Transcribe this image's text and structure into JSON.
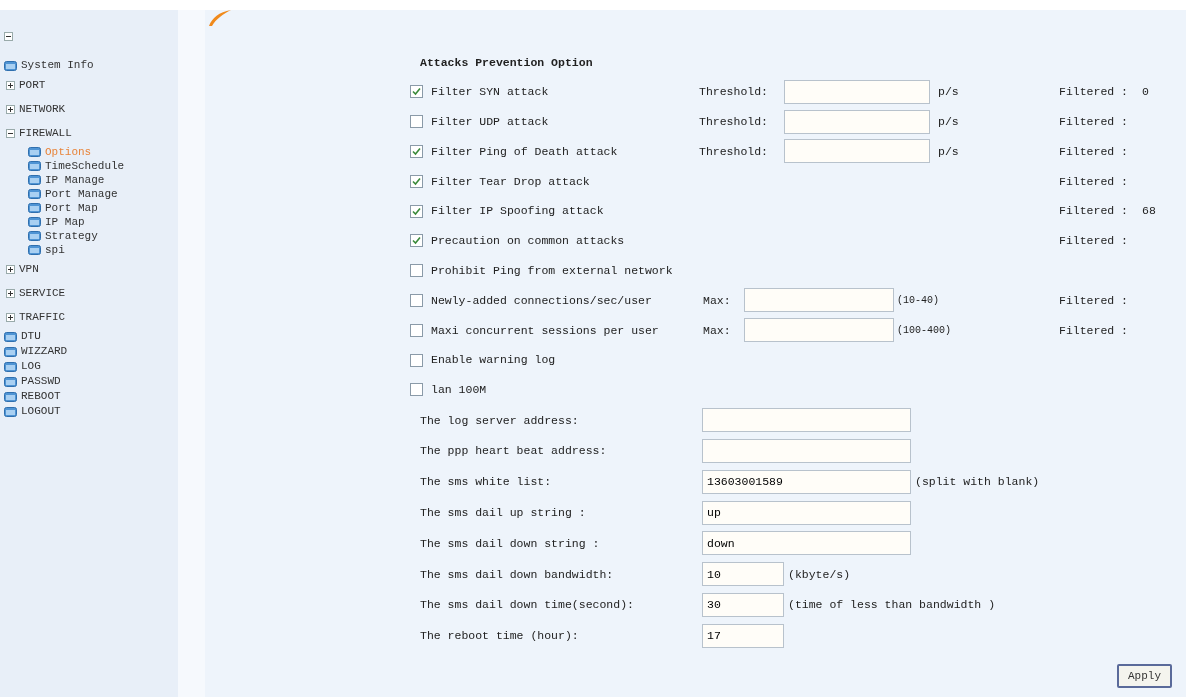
{
  "sidebar": {
    "expanded": true,
    "items": [
      {
        "label": "System Info",
        "kind": "leaf",
        "selected": false
      },
      {
        "label": "PORT",
        "kind": "folder",
        "expanded": false,
        "selected": false
      },
      {
        "label": "NETWORK",
        "kind": "folder",
        "expanded": false,
        "selected": false
      },
      {
        "label": "FIREWALL",
        "kind": "folder",
        "expanded": true,
        "selected": false,
        "children": [
          {
            "label": "Options",
            "kind": "leaf",
            "selected": true
          },
          {
            "label": "TimeSchedule",
            "kind": "leaf",
            "selected": false
          },
          {
            "label": "IP Manage",
            "kind": "leaf",
            "selected": false
          },
          {
            "label": "Port Manage",
            "kind": "leaf",
            "selected": false
          },
          {
            "label": "Port Map",
            "kind": "leaf",
            "selected": false
          },
          {
            "label": "IP Map",
            "kind": "leaf",
            "selected": false
          },
          {
            "label": "Strategy",
            "kind": "leaf",
            "selected": false
          },
          {
            "label": "spi",
            "kind": "leaf",
            "selected": false
          }
        ]
      },
      {
        "label": "VPN",
        "kind": "folder",
        "expanded": false,
        "selected": false
      },
      {
        "label": "SERVICE",
        "kind": "folder",
        "expanded": false,
        "selected": false
      },
      {
        "label": "TRAFFIC",
        "kind": "folder",
        "expanded": false,
        "selected": false
      },
      {
        "label": "DTU",
        "kind": "leaf",
        "selected": false
      },
      {
        "label": "WIZZARD",
        "kind": "leaf",
        "selected": false
      },
      {
        "label": "LOG",
        "kind": "leaf",
        "selected": false
      },
      {
        "label": "PASSWD",
        "kind": "leaf",
        "selected": false
      },
      {
        "label": "REBOOT",
        "kind": "leaf",
        "selected": false
      },
      {
        "label": "LOGOUT",
        "kind": "leaf",
        "selected": false
      }
    ]
  },
  "section_title": "Attacks Prevention Option",
  "attacks": [
    {
      "label": "Filter SYN attack",
      "checked": true,
      "kind": "threshold",
      "field_label": "Threshold:",
      "unit": "p/s",
      "filtered_label": "Filtered :",
      "filtered_value": "0"
    },
    {
      "label": "Filter UDP attack",
      "checked": false,
      "kind": "threshold",
      "field_label": "Threshold:",
      "unit": "p/s",
      "filtered_label": "Filtered :"
    },
    {
      "label": "Filter Ping of Death attack",
      "checked": true,
      "kind": "threshold",
      "field_label": "Threshold:",
      "unit": "p/s",
      "filtered_label": "Filtered :"
    },
    {
      "label": "Filter Tear Drop attack",
      "checked": true,
      "kind": "plain",
      "filtered_label": "Filtered :"
    },
    {
      "label": "Filter IP Spoofing attack",
      "checked": true,
      "kind": "plain",
      "filtered_label": "Filtered :",
      "filtered_value": "68"
    },
    {
      "label": "Precaution on common attacks",
      "checked": true,
      "kind": "plain",
      "filtered_label": "Filtered :"
    },
    {
      "label": "Prohibit Ping from external network",
      "checked": false,
      "kind": "plain"
    },
    {
      "label": "Newly-added connections/sec/user",
      "checked": false,
      "kind": "max",
      "field_label": "Max:",
      "unit": "(10-40)",
      "filtered_label": "Filtered :"
    },
    {
      "label": "Maxi concurrent sessions per user",
      "checked": false,
      "kind": "max",
      "field_label": "Max:",
      "unit": "(100-400)",
      "filtered_label": "Filtered :"
    },
    {
      "label": "Enable warning log",
      "checked": false,
      "kind": "plain"
    },
    {
      "label": "lan 100M",
      "checked": false,
      "kind": "plain"
    }
  ],
  "settings": [
    {
      "label": "The log server address:",
      "kind": "wide"
    },
    {
      "label": "The ppp heart beat address:",
      "kind": "wide"
    },
    {
      "label": "The sms white list:",
      "kind": "wide",
      "value": "13603001589",
      "hint": "(split with blank)"
    },
    {
      "label": "The sms dail up string :",
      "kind": "wide",
      "value": "up"
    },
    {
      "label": "The sms dail down string :",
      "kind": "wide",
      "value": "down"
    },
    {
      "label": "The sms dail down bandwidth:",
      "kind": "short",
      "value": "10",
      "hint": "(kbyte/s)"
    },
    {
      "label": "The sms dail down time(second):",
      "kind": "short",
      "value": "30",
      "hint": "(time of less than bandwidth )"
    },
    {
      "label": "The reboot time (hour):",
      "kind": "short",
      "value": "17"
    }
  ],
  "apply_button": "Apply"
}
